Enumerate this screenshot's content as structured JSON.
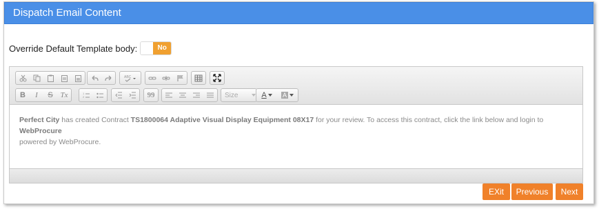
{
  "header": {
    "title": "Dispatch Email Content"
  },
  "override": {
    "label": "Override Default Template body:",
    "toggle_value": "No",
    "enabled": false
  },
  "toolbar": {
    "row1": [
      "cut-icon",
      "copy-icon",
      "paste-icon",
      "paste-text-icon",
      "paste-word-icon",
      "undo-icon",
      "redo-icon",
      "spellcheck-icon",
      "link-icon",
      "unlink-icon",
      "anchor-icon",
      "table-icon",
      "maximize-icon"
    ],
    "row2": [
      "bold-icon",
      "italic-icon",
      "strikethrough-icon",
      "remove-format-icon",
      "numbered-list-icon",
      "bulleted-list-icon",
      "outdent-icon",
      "indent-icon",
      "blockquote-icon",
      "align-left-icon",
      "align-center-icon",
      "align-right-icon",
      "justify-icon",
      "text-color-icon",
      "background-color-icon"
    ],
    "size_label": "Size",
    "bold_glyph": "B",
    "italic_glyph": "I",
    "strike_glyph": "S",
    "remove_format_glyph": "Tx",
    "quote_glyph": "99",
    "text_color_glyph": "A"
  },
  "content": {
    "org": "Perfect City",
    "t1": " has created Contract ",
    "contract": "TS1800064 Adaptive Visual Display Equipment 08X17",
    "t2": " for your review. To access this contract, click the link below and login to ",
    "brand": "WebProcure",
    "t3": "powered by WebProcure."
  },
  "buttons": {
    "exit": "EXit",
    "previous": "Previous",
    "next": "Next"
  },
  "colors": {
    "header": "#4a8fe7",
    "accent": "#f0812a",
    "toggle": "#f0a030"
  }
}
